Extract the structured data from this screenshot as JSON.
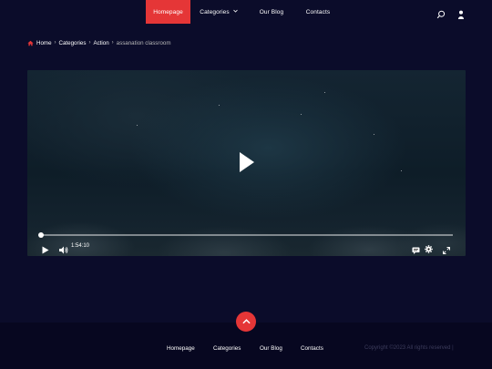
{
  "header": {
    "nav": [
      {
        "label": "Homepage",
        "active": true
      },
      {
        "label": "Categories",
        "has_dropdown": true
      },
      {
        "label": "Our Blog"
      },
      {
        "label": "Contacts"
      }
    ],
    "icons": [
      "search-icon",
      "user-icon"
    ],
    "accent_color": "#e53637"
  },
  "breadcrumb": {
    "items": [
      "Home",
      "Categories",
      "Action"
    ],
    "current": "assanation classroom"
  },
  "player": {
    "time": "1:54:10",
    "progress_fraction": 0.0,
    "controls": [
      "play-icon",
      "volume-icon",
      "captions-icon",
      "settings-icon",
      "fullscreen-icon"
    ]
  },
  "footer": {
    "links": [
      "Homepage",
      "Categories",
      "Our Blog",
      "Contacts"
    ],
    "copyright": "Copyright ©2023 All rights reserved |"
  }
}
